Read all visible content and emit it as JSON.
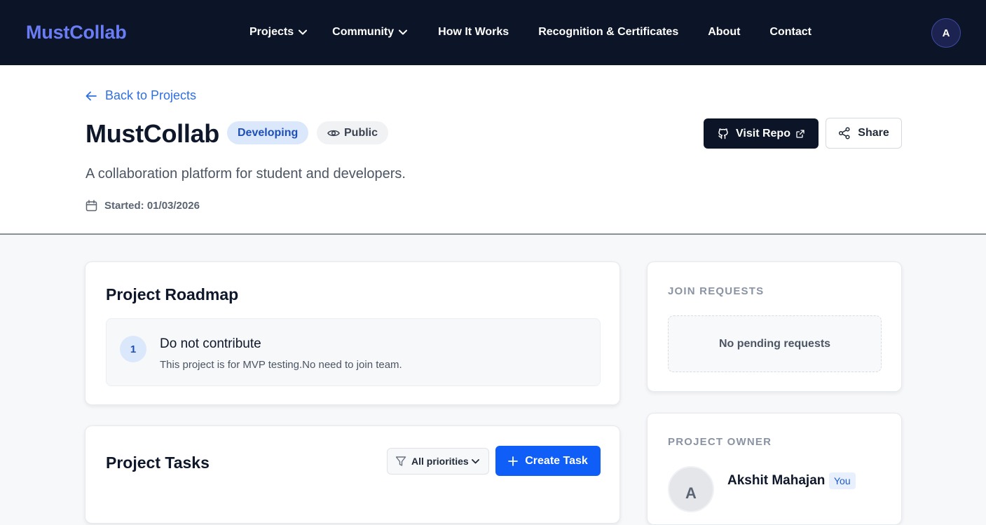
{
  "nav": {
    "brand": "MustCollab",
    "links": [
      {
        "label": "Projects",
        "dropdown": true
      },
      {
        "label": "Community",
        "dropdown": true
      },
      {
        "label": "How It Works",
        "dropdown": false
      },
      {
        "label": "Recognition & Certificates",
        "dropdown": false
      },
      {
        "label": "About",
        "dropdown": false
      },
      {
        "label": "Contact",
        "dropdown": false
      }
    ],
    "avatar_initial": "A"
  },
  "header": {
    "back_label": "Back to Projects",
    "title": "MustCollab",
    "status_badge": "Developing",
    "visibility_badge": "Public",
    "description": "A collaboration platform for student and developers.",
    "started": "Started: 01/03/2026",
    "visit_repo_label": "Visit Repo",
    "share_label": "Share"
  },
  "roadmap": {
    "title": "Project Roadmap",
    "items": [
      {
        "number": "1",
        "title": "Do not contribute",
        "description": "This project is for MVP testing.No need to join team."
      }
    ]
  },
  "tasks": {
    "title": "Project Tasks",
    "filter_value": "All priorities",
    "create_label": "Create Task"
  },
  "join_requests": {
    "label": "JOIN REQUESTS",
    "empty_text": "No pending requests"
  },
  "owner": {
    "label": "PROJECT OWNER",
    "avatar_initial": "A",
    "name": "Akshit Mahajan",
    "badge": "You"
  },
  "colors": {
    "nav_bg": "#0c1428",
    "brand": "#6b7df5",
    "link_blue": "#2f6fe0",
    "primary_button": "#0f5ef7",
    "developing_badge_bg": "#dbe8fc"
  },
  "icons": {
    "dropdown": "chevron-down-icon",
    "back": "arrow-left-icon",
    "visibility": "eye-icon",
    "started": "calendar-icon",
    "repo": "github-icon",
    "external": "external-link-icon",
    "share": "share-icon",
    "filter": "filter-icon",
    "create": "plus-icon"
  }
}
